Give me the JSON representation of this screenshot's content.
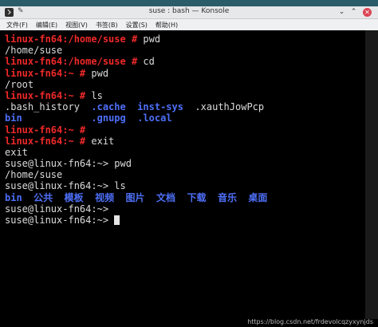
{
  "window": {
    "title": "suse : bash — Konsole",
    "pin_glyph": "✎",
    "min_glyph": "⌄",
    "max_glyph": "⌃",
    "close_glyph": "✕"
  },
  "menu": [
    "文件(F)",
    "编辑(E)",
    "视图(V)",
    "书签(B)",
    "设置(S)",
    "帮助(H)"
  ],
  "terminal": {
    "lines": [
      [
        {
          "t": "linux-fn64:/home/suse # ",
          "c": "prompt-red"
        },
        {
          "t": "pwd"
        }
      ],
      [
        {
          "t": "/home/suse"
        }
      ],
      [
        {
          "t": "linux-fn64:/home/suse # ",
          "c": "prompt-red"
        },
        {
          "t": "cd"
        }
      ],
      [
        {
          "t": "linux-fn64:~ # ",
          "c": "prompt-red"
        },
        {
          "t": "pwd"
        }
      ],
      [
        {
          "t": "/root"
        }
      ],
      [
        {
          "t": "linux-fn64:~ # ",
          "c": "prompt-red"
        },
        {
          "t": "ls"
        }
      ],
      [
        {
          "t": ".bash_history  "
        },
        {
          "t": ".cache",
          "c": "dir-blue"
        },
        {
          "t": "  "
        },
        {
          "t": "inst-sys",
          "c": "dir-blue"
        },
        {
          "t": "  .xauthJowPcp"
        }
      ],
      [
        {
          "t": "bin",
          "c": "dir-blue"
        },
        {
          "t": "            "
        },
        {
          "t": ".gnupg",
          "c": "dir-blue"
        },
        {
          "t": "  "
        },
        {
          "t": ".local",
          "c": "dir-blue"
        }
      ],
      [
        {
          "t": "linux-fn64:~ # ",
          "c": "prompt-red"
        }
      ],
      [
        {
          "t": "linux-fn64:~ # ",
          "c": "prompt-red"
        },
        {
          "t": "exit"
        }
      ],
      [
        {
          "t": "exit"
        }
      ],
      [
        {
          "t": "suse@linux-fn64:~> pwd"
        }
      ],
      [
        {
          "t": "/home/suse"
        }
      ],
      [
        {
          "t": "suse@linux-fn64:~> ls"
        }
      ],
      [
        {
          "t": "bin",
          "c": "dir-blue"
        },
        {
          "t": "  "
        },
        {
          "t": "公共",
          "c": "dir-blue"
        },
        {
          "t": "  "
        },
        {
          "t": "模板",
          "c": "dir-blue"
        },
        {
          "t": "  "
        },
        {
          "t": "视频",
          "c": "dir-blue"
        },
        {
          "t": "  "
        },
        {
          "t": "图片",
          "c": "dir-blue"
        },
        {
          "t": "  "
        },
        {
          "t": "文档",
          "c": "dir-blue"
        },
        {
          "t": "  "
        },
        {
          "t": "下载",
          "c": "dir-blue"
        },
        {
          "t": "  "
        },
        {
          "t": "音乐",
          "c": "dir-blue"
        },
        {
          "t": "  "
        },
        {
          "t": "桌面",
          "c": "dir-blue"
        }
      ],
      [
        {
          "t": "suse@linux-fn64:~> "
        }
      ],
      [
        {
          "t": "suse@linux-fn64:~> "
        },
        {
          "cursor": true
        }
      ]
    ]
  },
  "watermark": "https://blog.csdn.net/frdevolcqzyxynjds",
  "colors": {
    "prompt": "#ef2929",
    "directory": "#4d6ff7",
    "background": "#000000",
    "text": "#dcdcdc"
  }
}
